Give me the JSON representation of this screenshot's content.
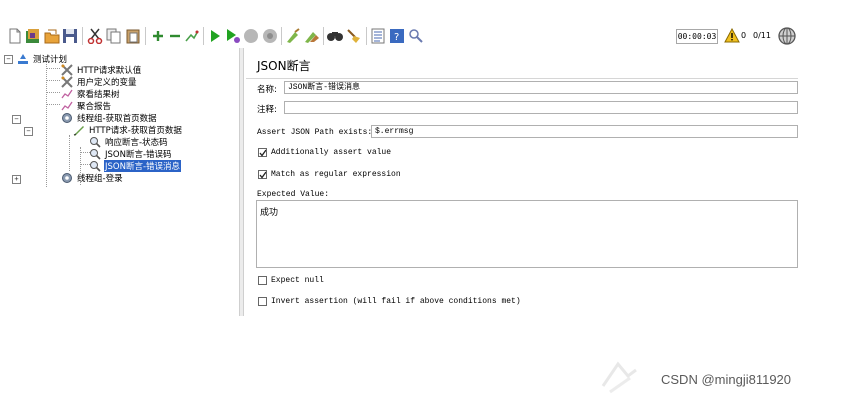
{
  "toolbar": {
    "icons": [
      "new-file-icon",
      "templates-icon",
      "open-folder-icon",
      "save-icon",
      "cut-icon",
      "copy-icon",
      "paste-icon",
      "expand-plus-icon",
      "collapse-minus-icon",
      "toggle-icon",
      "start-icon",
      "start-no-pause-icon",
      "stop-icon",
      "shutdown-icon",
      "clear-icon",
      "clear-all-icon",
      "search-binoculars-icon",
      "reset-search-broom-icon",
      "function-helper-icon",
      "help-icon",
      "remote-icon"
    ],
    "timer": "00:00:03",
    "warning_count": "0",
    "thread_count": "0/11"
  },
  "tree": {
    "items": [
      {
        "label": "测试计划",
        "icon": "test-plan-icon",
        "selected": false
      },
      {
        "label": "HTTP请求默认值",
        "icon": "config-wrench-icon",
        "selected": false
      },
      {
        "label": "用户定义的变量",
        "icon": "config-wrench-icon",
        "selected": false
      },
      {
        "label": "察看结果树",
        "icon": "listener-graph-icon",
        "selected": false
      },
      {
        "label": "聚合报告",
        "icon": "listener-graph-icon",
        "selected": false
      },
      {
        "label": "线程组-获取首页数据",
        "icon": "thread-group-gear-icon",
        "selected": false
      },
      {
        "label": "HTTP请求-获取首页数据",
        "icon": "sampler-pen-icon",
        "selected": false
      },
      {
        "label": "响应断言-状态码",
        "icon": "assertion-magnifier-icon",
        "selected": false
      },
      {
        "label": "JSON断言-错误码",
        "icon": "assertion-magnifier-icon",
        "selected": false
      },
      {
        "label": "JSON断言-错误消息",
        "icon": "assertion-magnifier-icon",
        "selected": true
      },
      {
        "label": "线程组-登录",
        "icon": "thread-group-gear-icon",
        "selected": false
      }
    ]
  },
  "panel": {
    "title": "JSON断言",
    "name_label": "名称:",
    "name_value": "JSON断言-错误消息",
    "comment_label": "注释:",
    "comment_value": "",
    "path_label": "Assert JSON Path exists:",
    "path_value": "$.errmsg",
    "additionally_assert": {
      "label": "Additionally assert value",
      "checked": true
    },
    "match_regex": {
      "label": "Match as regular expression",
      "checked": true
    },
    "expected_label": "Expected Value:",
    "expected_value": "成功",
    "expect_null": {
      "label": "Expect null",
      "checked": false
    },
    "invert": {
      "label": "Invert assertion (will fail if above conditions met)",
      "checked": false
    }
  },
  "watermark": "CSDN @mingji811920"
}
